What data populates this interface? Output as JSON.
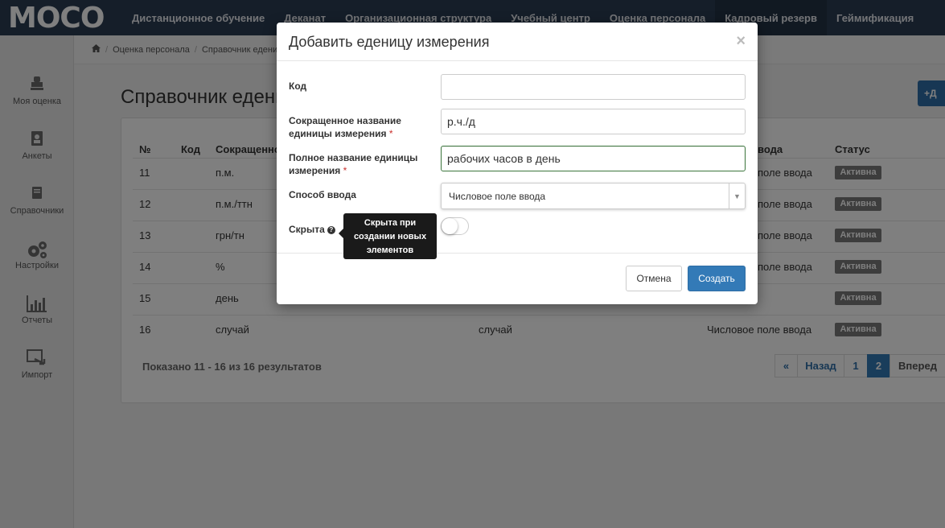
{
  "brand": {
    "logo_text": "MOCO"
  },
  "topnav": {
    "items": [
      {
        "label": "Дистанционное обучение"
      },
      {
        "label": "Деканат"
      },
      {
        "label": "Организационная структура"
      },
      {
        "label": "Учебный центр"
      },
      {
        "label": "Оценка персонала"
      },
      {
        "label": "Кадровый резерв"
      },
      {
        "label": "Геймификация"
      }
    ]
  },
  "sidebar": {
    "items": [
      {
        "label": "Моя оценка",
        "icon": "stamp-icon"
      },
      {
        "label": "Анкеты",
        "icon": "address-book-icon"
      },
      {
        "label": "Справочники",
        "icon": "book-icon"
      },
      {
        "label": "Настройки",
        "icon": "gears-icon"
      },
      {
        "label": "Отчеты",
        "icon": "bar-chart-icon"
      },
      {
        "label": "Импорт",
        "icon": "import-icon"
      }
    ]
  },
  "breadcrumb": {
    "items": [
      "Оценка персонала",
      "Справочник едени"
    ]
  },
  "page": {
    "title": "Справочник едени",
    "add_button_label": "+Д"
  },
  "table": {
    "headers": {
      "num": "№",
      "code": "Код",
      "short_name": "Сокращенно",
      "input_method": "вода",
      "status": "Статус"
    },
    "rows": [
      {
        "num": "11",
        "short": "п.м.",
        "full": "",
        "method": "поле ввода",
        "status": "Активна"
      },
      {
        "num": "12",
        "short": "п.м./ттн",
        "full": "",
        "method": "поле ввода",
        "status": "Активна"
      },
      {
        "num": "13",
        "short": "грн/тн",
        "full": "",
        "method": "поле ввода",
        "status": "Активна"
      },
      {
        "num": "14",
        "short": "%",
        "full": "",
        "method": "поле ввода",
        "status": "Активна"
      },
      {
        "num": "15",
        "short": "день",
        "full": "",
        "method": "",
        "status": "Активна"
      },
      {
        "num": "16",
        "short": "случай",
        "full": "случай",
        "method": "Числовое поле ввода",
        "status": "Активна"
      }
    ],
    "summary": "Показано 11 - 16 из 16 результатов"
  },
  "pagination": {
    "first": "«",
    "prev": "Назад",
    "pages": [
      "1",
      "2"
    ],
    "current": "2",
    "next": "Вперед"
  },
  "modal": {
    "title": "Добавить еденицу измерения",
    "close": "×",
    "fields": {
      "code": {
        "label": "Код",
        "value": ""
      },
      "short_name": {
        "label": "Сокращенное название единицы измерения",
        "required_mark": "*",
        "value": "р.ч./д"
      },
      "full_name": {
        "label": "Полное название единицы измерения",
        "required_mark": "*",
        "value": "рабочих часов в день"
      },
      "input_method": {
        "label": "Способ ввода",
        "value": "Числовое поле ввода"
      },
      "hidden": {
        "label": "Скрыта",
        "checked": false
      }
    },
    "tooltip": "Скрыта при создании новых элементов",
    "buttons": {
      "cancel": "Отмена",
      "create": "Создать"
    }
  },
  "colors": {
    "topnav_bg": "#2a3d52",
    "primary": "#337ab7",
    "badge_bg": "#7a7a7a"
  }
}
